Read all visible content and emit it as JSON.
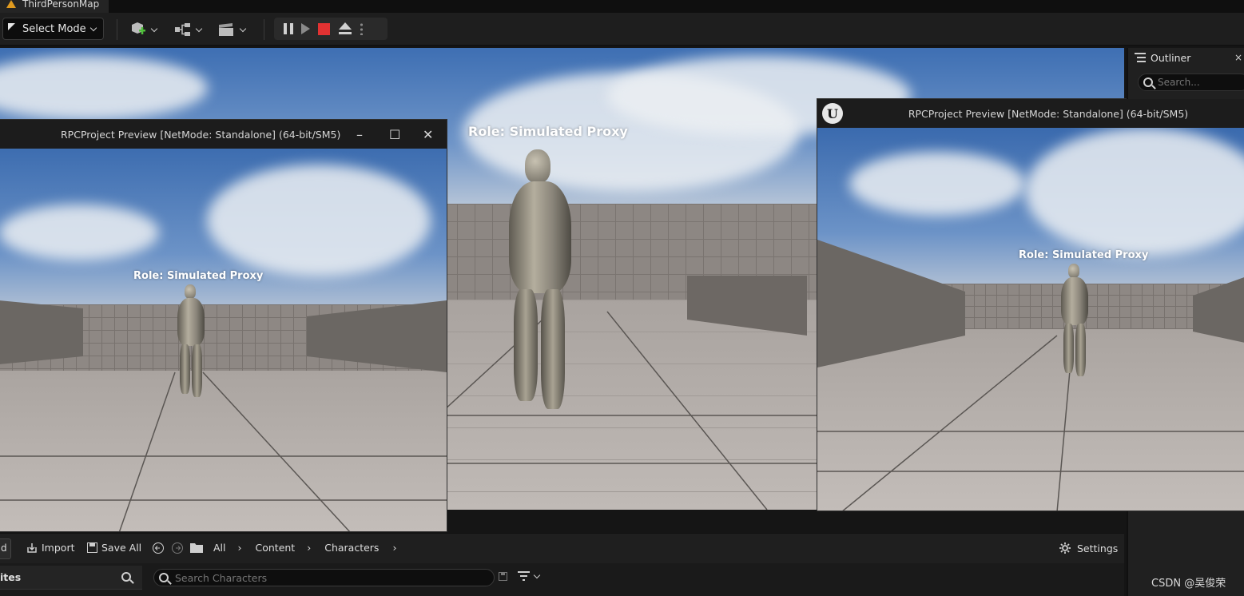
{
  "window": {
    "map_tab": "ThirdPersonMap"
  },
  "toolbar": {
    "mode_label": "Select Mode"
  },
  "viewport": {
    "role_label": "Role: Simulated Proxy"
  },
  "preview_left": {
    "title": "RPCProject Preview [NetMode: Standalone]  (64-bit/SM5)",
    "role_label": "Role: Simulated Proxy",
    "minimize": "–",
    "maximize": "☐",
    "close": "✕"
  },
  "preview_right": {
    "title": "RPCProject Preview [NetMode: Standalone]  (64-bit/SM5)",
    "role_label": "Role: Simulated Proxy",
    "logo": "U"
  },
  "outliner": {
    "title": "Outliner",
    "search_placeholder": "Search...",
    "close": "×"
  },
  "content_browser": {
    "add_label": "d",
    "import_label": "Import",
    "save_all_label": "Save All",
    "breadcrumb": [
      "All",
      "Content",
      "Characters"
    ],
    "settings_label": "Settings",
    "favorites_label": "ites",
    "search_placeholder": "Search Characters"
  },
  "watermark": "CSDN @吴俊荣",
  "colors": {
    "stop": "#e23232",
    "engine_accent": "#e09a1f",
    "panel": "#1e1e1e"
  }
}
